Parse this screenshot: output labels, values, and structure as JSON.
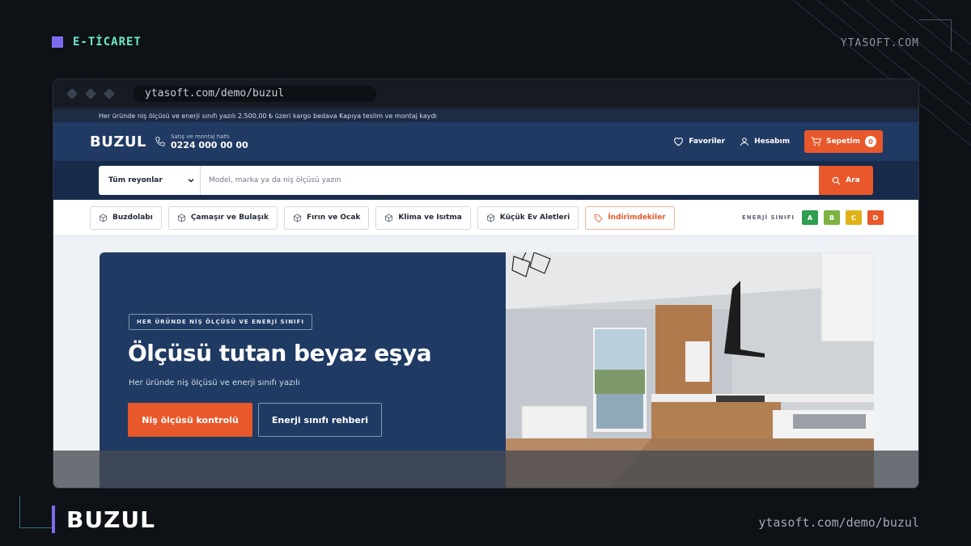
{
  "frame": {
    "tag": "E-TİCARET",
    "site_top": "YTASOFT.COM",
    "brand": "BUZUL",
    "site_bottom": "ytasoft.com/demo/buzul"
  },
  "browser": {
    "url": "ytasoft.com/demo/buzul"
  },
  "store": {
    "announcement": "Her üründe niş ölçüsü ve enerji sınıfı yazılı 2.500,00 ₺ üzeri kargo bedava Kapıya teslim ve montaj kaydı",
    "logo": "BUZUL",
    "hotline_label": "Satış ve montaj hattı",
    "hotline_number": "0224 000 00 00",
    "favorites": "Favoriler",
    "account": "Hesabım",
    "cart": "Sepetim",
    "cart_count": "0",
    "department": "Tüm reyonlar",
    "search_placeholder": "Model, marka ya da niş ölçüsü yazın",
    "search_button": "Ara",
    "categories": [
      "Buzdolabı",
      "Çamaşır ve Bulaşık",
      "Fırın ve Ocak",
      "Klima ve Isıtma",
      "Küçük Ev Aletleri"
    ],
    "deals": "İndirimdekiler",
    "energy_label": "ENERJİ SINIFI",
    "energy_classes": [
      {
        "label": "A",
        "color": "#2e9e4f"
      },
      {
        "label": "B",
        "color": "#7cb342"
      },
      {
        "label": "C",
        "color": "#e0b21a"
      },
      {
        "label": "D",
        "color": "#e8582a"
      }
    ]
  },
  "hero": {
    "badge": "HER ÜRÜNDE NİŞ ÖLÇÜSÜ VE ENERJİ SINIFI",
    "title": "Ölçüsü tutan beyaz eşya",
    "subtitle": "Her üründe niş ölçüsü ve enerji sınıfı yazılı",
    "primary_button": "Niş ölçüsü kontrolü",
    "secondary_button": "Enerji sınıfı rehberi"
  },
  "colors": {
    "accent": "#e8582a",
    "navy": "#213a63",
    "frame_bg": "#0e1116"
  }
}
